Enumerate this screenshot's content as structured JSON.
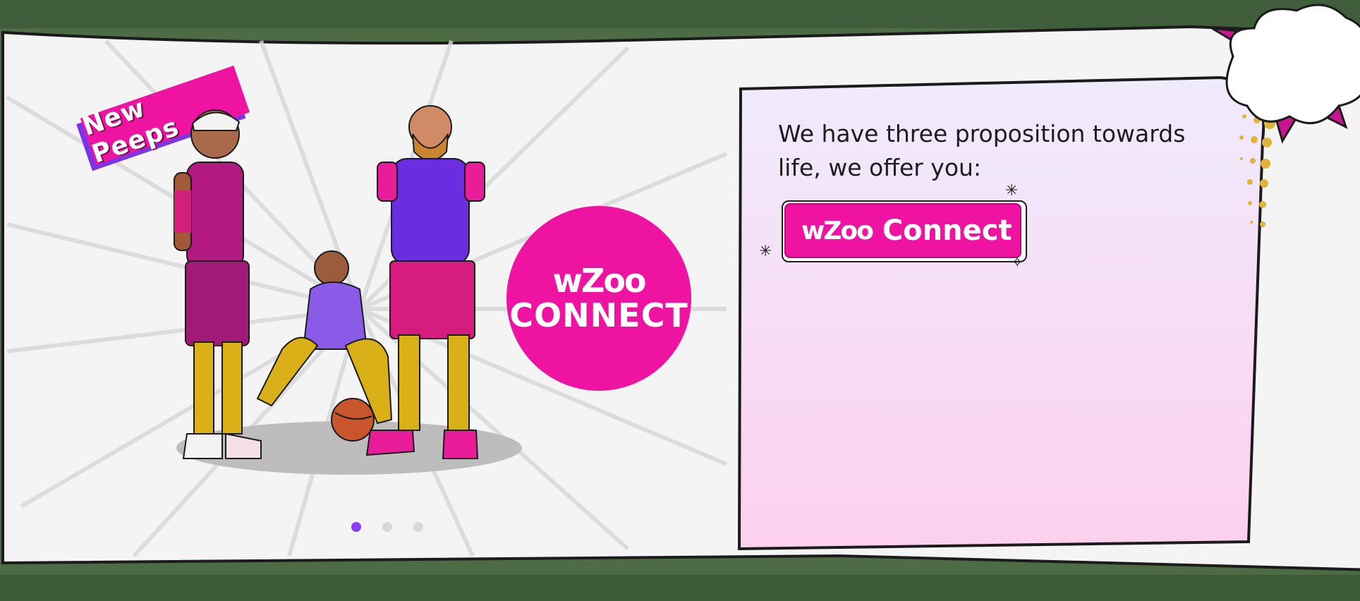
{
  "badge": {
    "text": "New Peeps"
  },
  "circle_logo": {
    "brand": "wZoo",
    "word": "CONNECT"
  },
  "card": {
    "text": "We have three proposition towards life, we offer you:",
    "button": {
      "brand": "wZoo",
      "label": "Connect"
    }
  },
  "carousel": {
    "total": 3,
    "active_index": 0
  },
  "colors": {
    "accent_pink": "#ee13a0",
    "accent_purple": "#7c35e6",
    "card_gradient_top": "#f0ebfd",
    "card_gradient_bottom": "#fdd0ee"
  },
  "icons": {
    "sparkles": [
      "star-sparkle-icon",
      "asterisk-sparkle-icon",
      "four-point-star-icon"
    ],
    "decor": [
      "comic-cloud-icon",
      "halftone-dots-icon"
    ]
  }
}
